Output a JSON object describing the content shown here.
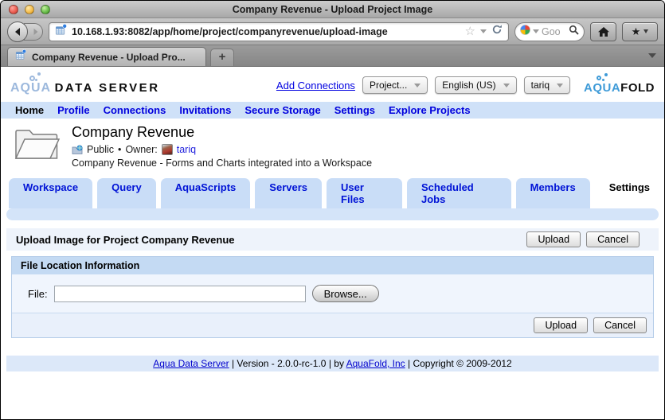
{
  "browser": {
    "window_title": "Company Revenue - Upload Project Image",
    "url": "10.168.1.93:8082/app/home/project/companyrevenue/upload-image",
    "tab_title": "Company Revenue - Upload Pro...",
    "new_tab": "+",
    "search_text": "Goo"
  },
  "header": {
    "logo_primary": "AQUA",
    "logo_secondary": "DATA SERVER",
    "add_connections_link": "Add Connections",
    "project_select": "Project...",
    "language_select": "English (US)",
    "user_select": "tariq",
    "brand_primary": "AQUA",
    "brand_secondary": "FOLD"
  },
  "nav": {
    "items": [
      "Home",
      "Profile",
      "Connections",
      "Invitations",
      "Secure Storage",
      "Settings",
      "Explore Projects"
    ],
    "active": "Home"
  },
  "project": {
    "title": "Company Revenue",
    "visibility": "Public",
    "bullet": "•",
    "owner_label": "Owner:",
    "owner_name": "tariq",
    "description": "Company Revenue - Forms and Charts integrated into a Workspace"
  },
  "tabs": {
    "items": [
      "Workspace",
      "Query",
      "AquaScripts",
      "Servers",
      "User Files",
      "Scheduled Jobs",
      "Members",
      "Settings"
    ],
    "active": "Settings"
  },
  "upload": {
    "heading": "Upload Image for Project Company Revenue",
    "upload_button": "Upload",
    "cancel_button": "Cancel",
    "section_heading": "File Location Information",
    "file_label": "File:",
    "file_value": "",
    "browse_button": "Browse..."
  },
  "footer": {
    "product_link": "Aqua Data Server",
    "version_text": "| Version - 2.0.0-rc-1.0 | by",
    "company_link": "AquaFold, Inc",
    "copyright_text": "| Copyright © 2009-2012"
  },
  "colors": {
    "link_blue": "#0000dd",
    "band_blue": "#cfe1f8",
    "section_header_blue": "#c4daf3",
    "tab_blue": "#c9ddf7"
  }
}
